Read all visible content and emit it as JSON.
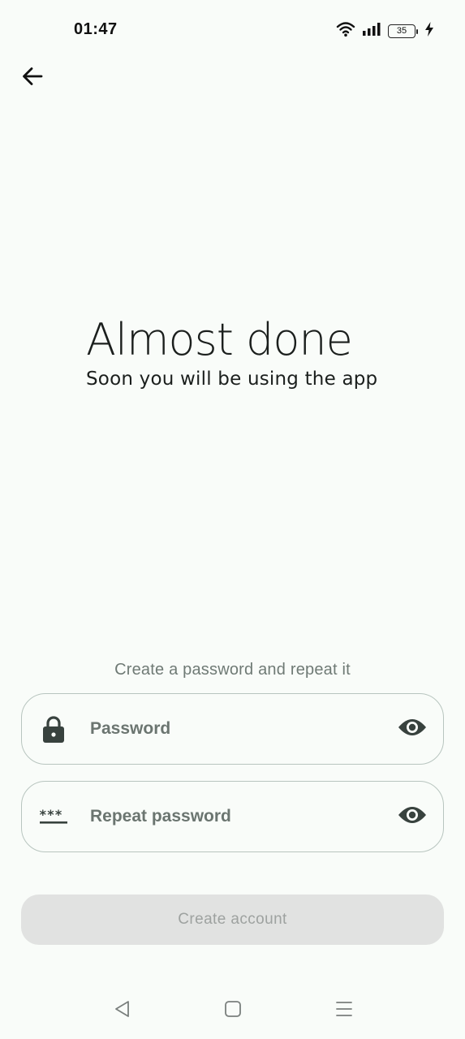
{
  "status_bar": {
    "time": "01:47",
    "battery_level": "35",
    "icons": [
      "wifi-icon",
      "signal-icon",
      "battery-icon",
      "charging-bolt-icon"
    ]
  },
  "header": {
    "back_icon": "arrow-back-icon"
  },
  "heading": {
    "title": "Almost done",
    "subtitle": "Soon you will be using the app"
  },
  "form": {
    "instruction": "Create a password and repeat it",
    "password": {
      "placeholder": "Password",
      "value": "",
      "lead_icon": "lock-icon",
      "trail_icon": "eye-icon"
    },
    "repeat_password": {
      "placeholder": "Repeat password",
      "value": "",
      "lead_icon": "password-dots-icon",
      "trail_icon": "eye-icon"
    },
    "submit_label": "Create account"
  },
  "nav_bar": {
    "icons": [
      "nav-back-icon",
      "nav-home-icon",
      "nav-recents-icon"
    ]
  },
  "colors": {
    "background": "#f9fcf9",
    "field_border": "#b8c5bf",
    "icon": "#38423e",
    "button_disabled_bg": "#e1e2e1",
    "button_disabled_text": "#9ea2a0"
  }
}
